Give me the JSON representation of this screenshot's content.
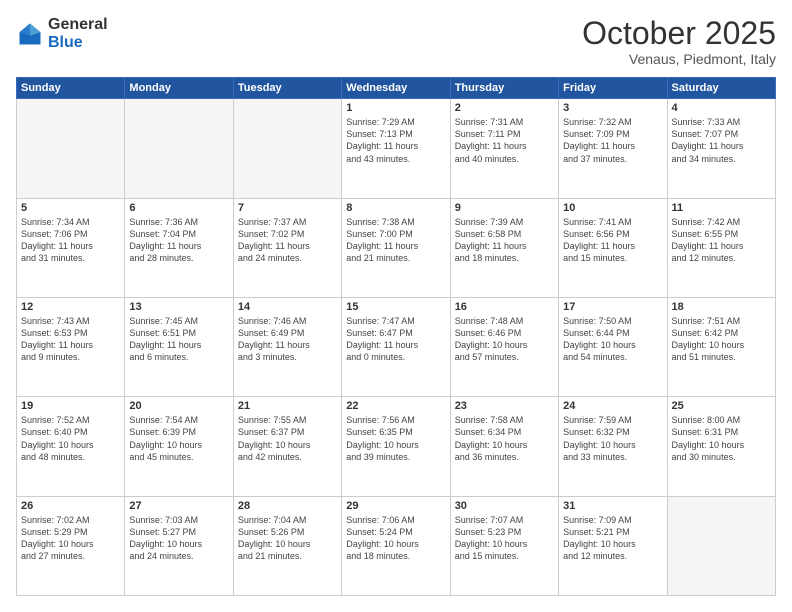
{
  "logo": {
    "general": "General",
    "blue": "Blue"
  },
  "header": {
    "month": "October 2025",
    "location": "Venaus, Piedmont, Italy"
  },
  "weekdays": [
    "Sunday",
    "Monday",
    "Tuesday",
    "Wednesday",
    "Thursday",
    "Friday",
    "Saturday"
  ],
  "weeks": [
    [
      {
        "num": "",
        "info": ""
      },
      {
        "num": "",
        "info": ""
      },
      {
        "num": "",
        "info": ""
      },
      {
        "num": "1",
        "info": "Sunrise: 7:29 AM\nSunset: 7:13 PM\nDaylight: 11 hours\nand 43 minutes."
      },
      {
        "num": "2",
        "info": "Sunrise: 7:31 AM\nSunset: 7:11 PM\nDaylight: 11 hours\nand 40 minutes."
      },
      {
        "num": "3",
        "info": "Sunrise: 7:32 AM\nSunset: 7:09 PM\nDaylight: 11 hours\nand 37 minutes."
      },
      {
        "num": "4",
        "info": "Sunrise: 7:33 AM\nSunset: 7:07 PM\nDaylight: 11 hours\nand 34 minutes."
      }
    ],
    [
      {
        "num": "5",
        "info": "Sunrise: 7:34 AM\nSunset: 7:06 PM\nDaylight: 11 hours\nand 31 minutes."
      },
      {
        "num": "6",
        "info": "Sunrise: 7:36 AM\nSunset: 7:04 PM\nDaylight: 11 hours\nand 28 minutes."
      },
      {
        "num": "7",
        "info": "Sunrise: 7:37 AM\nSunset: 7:02 PM\nDaylight: 11 hours\nand 24 minutes."
      },
      {
        "num": "8",
        "info": "Sunrise: 7:38 AM\nSunset: 7:00 PM\nDaylight: 11 hours\nand 21 minutes."
      },
      {
        "num": "9",
        "info": "Sunrise: 7:39 AM\nSunset: 6:58 PM\nDaylight: 11 hours\nand 18 minutes."
      },
      {
        "num": "10",
        "info": "Sunrise: 7:41 AM\nSunset: 6:56 PM\nDaylight: 11 hours\nand 15 minutes."
      },
      {
        "num": "11",
        "info": "Sunrise: 7:42 AM\nSunset: 6:55 PM\nDaylight: 11 hours\nand 12 minutes."
      }
    ],
    [
      {
        "num": "12",
        "info": "Sunrise: 7:43 AM\nSunset: 6:53 PM\nDaylight: 11 hours\nand 9 minutes."
      },
      {
        "num": "13",
        "info": "Sunrise: 7:45 AM\nSunset: 6:51 PM\nDaylight: 11 hours\nand 6 minutes."
      },
      {
        "num": "14",
        "info": "Sunrise: 7:46 AM\nSunset: 6:49 PM\nDaylight: 11 hours\nand 3 minutes."
      },
      {
        "num": "15",
        "info": "Sunrise: 7:47 AM\nSunset: 6:47 PM\nDaylight: 11 hours\nand 0 minutes."
      },
      {
        "num": "16",
        "info": "Sunrise: 7:48 AM\nSunset: 6:46 PM\nDaylight: 10 hours\nand 57 minutes."
      },
      {
        "num": "17",
        "info": "Sunrise: 7:50 AM\nSunset: 6:44 PM\nDaylight: 10 hours\nand 54 minutes."
      },
      {
        "num": "18",
        "info": "Sunrise: 7:51 AM\nSunset: 6:42 PM\nDaylight: 10 hours\nand 51 minutes."
      }
    ],
    [
      {
        "num": "19",
        "info": "Sunrise: 7:52 AM\nSunset: 6:40 PM\nDaylight: 10 hours\nand 48 minutes."
      },
      {
        "num": "20",
        "info": "Sunrise: 7:54 AM\nSunset: 6:39 PM\nDaylight: 10 hours\nand 45 minutes."
      },
      {
        "num": "21",
        "info": "Sunrise: 7:55 AM\nSunset: 6:37 PM\nDaylight: 10 hours\nand 42 minutes."
      },
      {
        "num": "22",
        "info": "Sunrise: 7:56 AM\nSunset: 6:35 PM\nDaylight: 10 hours\nand 39 minutes."
      },
      {
        "num": "23",
        "info": "Sunrise: 7:58 AM\nSunset: 6:34 PM\nDaylight: 10 hours\nand 36 minutes."
      },
      {
        "num": "24",
        "info": "Sunrise: 7:59 AM\nSunset: 6:32 PM\nDaylight: 10 hours\nand 33 minutes."
      },
      {
        "num": "25",
        "info": "Sunrise: 8:00 AM\nSunset: 6:31 PM\nDaylight: 10 hours\nand 30 minutes."
      }
    ],
    [
      {
        "num": "26",
        "info": "Sunrise: 7:02 AM\nSunset: 5:29 PM\nDaylight: 10 hours\nand 27 minutes."
      },
      {
        "num": "27",
        "info": "Sunrise: 7:03 AM\nSunset: 5:27 PM\nDaylight: 10 hours\nand 24 minutes."
      },
      {
        "num": "28",
        "info": "Sunrise: 7:04 AM\nSunset: 5:26 PM\nDaylight: 10 hours\nand 21 minutes."
      },
      {
        "num": "29",
        "info": "Sunrise: 7:06 AM\nSunset: 5:24 PM\nDaylight: 10 hours\nand 18 minutes."
      },
      {
        "num": "30",
        "info": "Sunrise: 7:07 AM\nSunset: 5:23 PM\nDaylight: 10 hours\nand 15 minutes."
      },
      {
        "num": "31",
        "info": "Sunrise: 7:09 AM\nSunset: 5:21 PM\nDaylight: 10 hours\nand 12 minutes."
      },
      {
        "num": "",
        "info": ""
      }
    ]
  ]
}
